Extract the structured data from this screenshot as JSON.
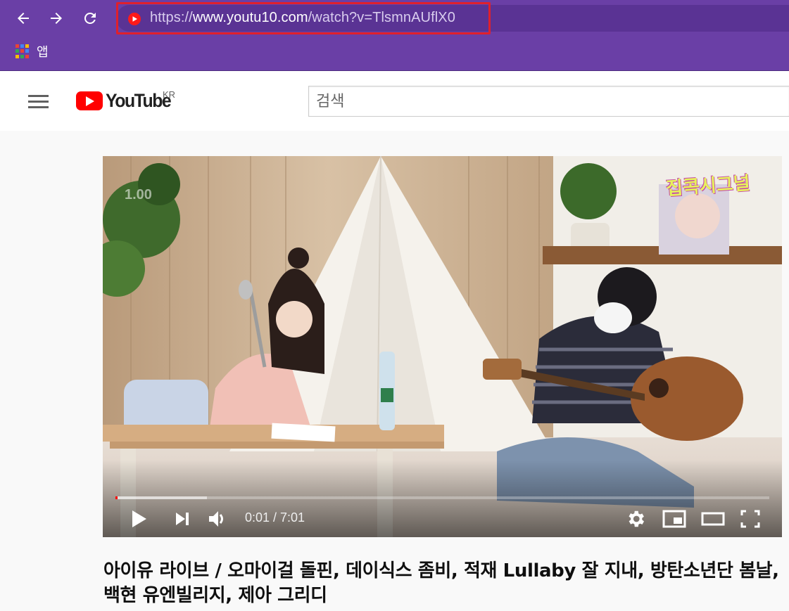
{
  "browser": {
    "url_prefix": "https://",
    "url_host": "www.youtu10.com",
    "url_path": "/watch?v=TlsmnAUflX0",
    "bookmarks": [
      {
        "label": "앱"
      }
    ],
    "colors": {
      "frame": "#6a3fa6",
      "highlight": "#e0202c"
    }
  },
  "header": {
    "logo_text": "YouTube",
    "region": "KR",
    "search_placeholder": "검색"
  },
  "player": {
    "speed_overlay": "1.00",
    "watermark": "집콕시그널",
    "current_time": "0:01",
    "duration": "7:01",
    "time_display": "0:01 / 7:01",
    "progress_fraction": 0.0024,
    "buffered_fraction": 0.14
  },
  "video": {
    "title": "아이유 라이브 / 오마이걸 돌핀, 데이식스 좀비, 적재 Lullaby 잘 지내, 방탄소년단 봄날, 백현 유엔빌리지, 제아 그리디"
  }
}
